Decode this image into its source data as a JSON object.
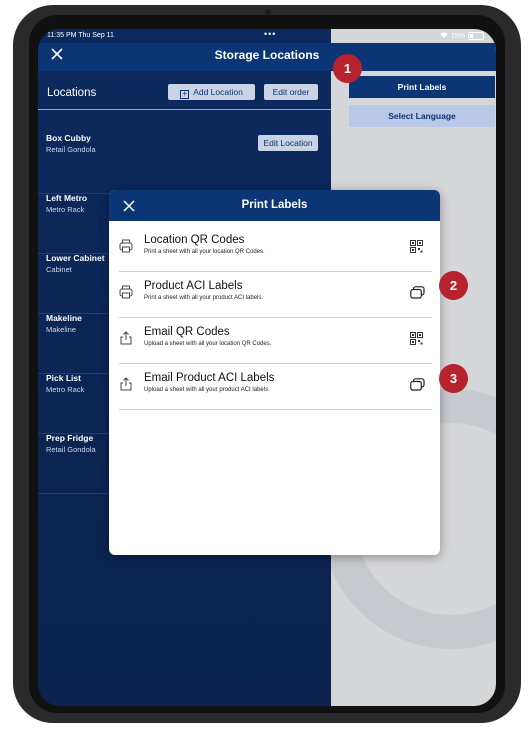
{
  "status_bar": {
    "time": "11:35 PM  Thu Sep 11",
    "dots": "•••",
    "battery": "15%"
  },
  "header": {
    "title": "Storage Locations"
  },
  "locations_panel": {
    "label": "Locations",
    "add_location_label": "Add Location",
    "edit_order_label": "Edit order",
    "edit_location_label": "Edit Location",
    "items": [
      {
        "name": "Box Cubby",
        "type": "Retail Gondola"
      },
      {
        "name": "Left Metro",
        "type": "Metro Rack"
      },
      {
        "name": "Lower Cabinet",
        "type": "Cabinet"
      },
      {
        "name": "Makeline",
        "type": "Makeline"
      },
      {
        "name": "Pick List",
        "type": "Metro Rack"
      },
      {
        "name": "Prep Fridge",
        "type": "Retail Gondola"
      }
    ]
  },
  "right_panel": {
    "print_labels": "Print Labels",
    "select_language": "Select Language"
  },
  "modal": {
    "title": "Print Labels",
    "options": [
      {
        "title": "Location QR Codes",
        "description": "Print a sheet with all your location QR Codes.",
        "left_icon": "printer-icon",
        "right_icon": "qr-code-icon"
      },
      {
        "title": "Product ACI Labels",
        "description": "Print a sheet with all your product ACI labels.",
        "left_icon": "printer-icon",
        "right_icon": "labels-icon"
      },
      {
        "title": "Email QR Codes",
        "description": "Upload a sheet with all your location QR Codes.",
        "left_icon": "share-icon",
        "right_icon": "qr-code-icon"
      },
      {
        "title": "Email Product ACI Labels",
        "description": "Upload a sheet with all your product ACI labels.",
        "left_icon": "share-icon",
        "right_icon": "labels-icon"
      }
    ]
  },
  "markers": [
    "1",
    "2",
    "3"
  ],
  "colors": {
    "navy": "#0b3575",
    "dark_navy": "#0a2350",
    "marker_red": "#b6232e",
    "light_blue": "#b9c8e6"
  }
}
